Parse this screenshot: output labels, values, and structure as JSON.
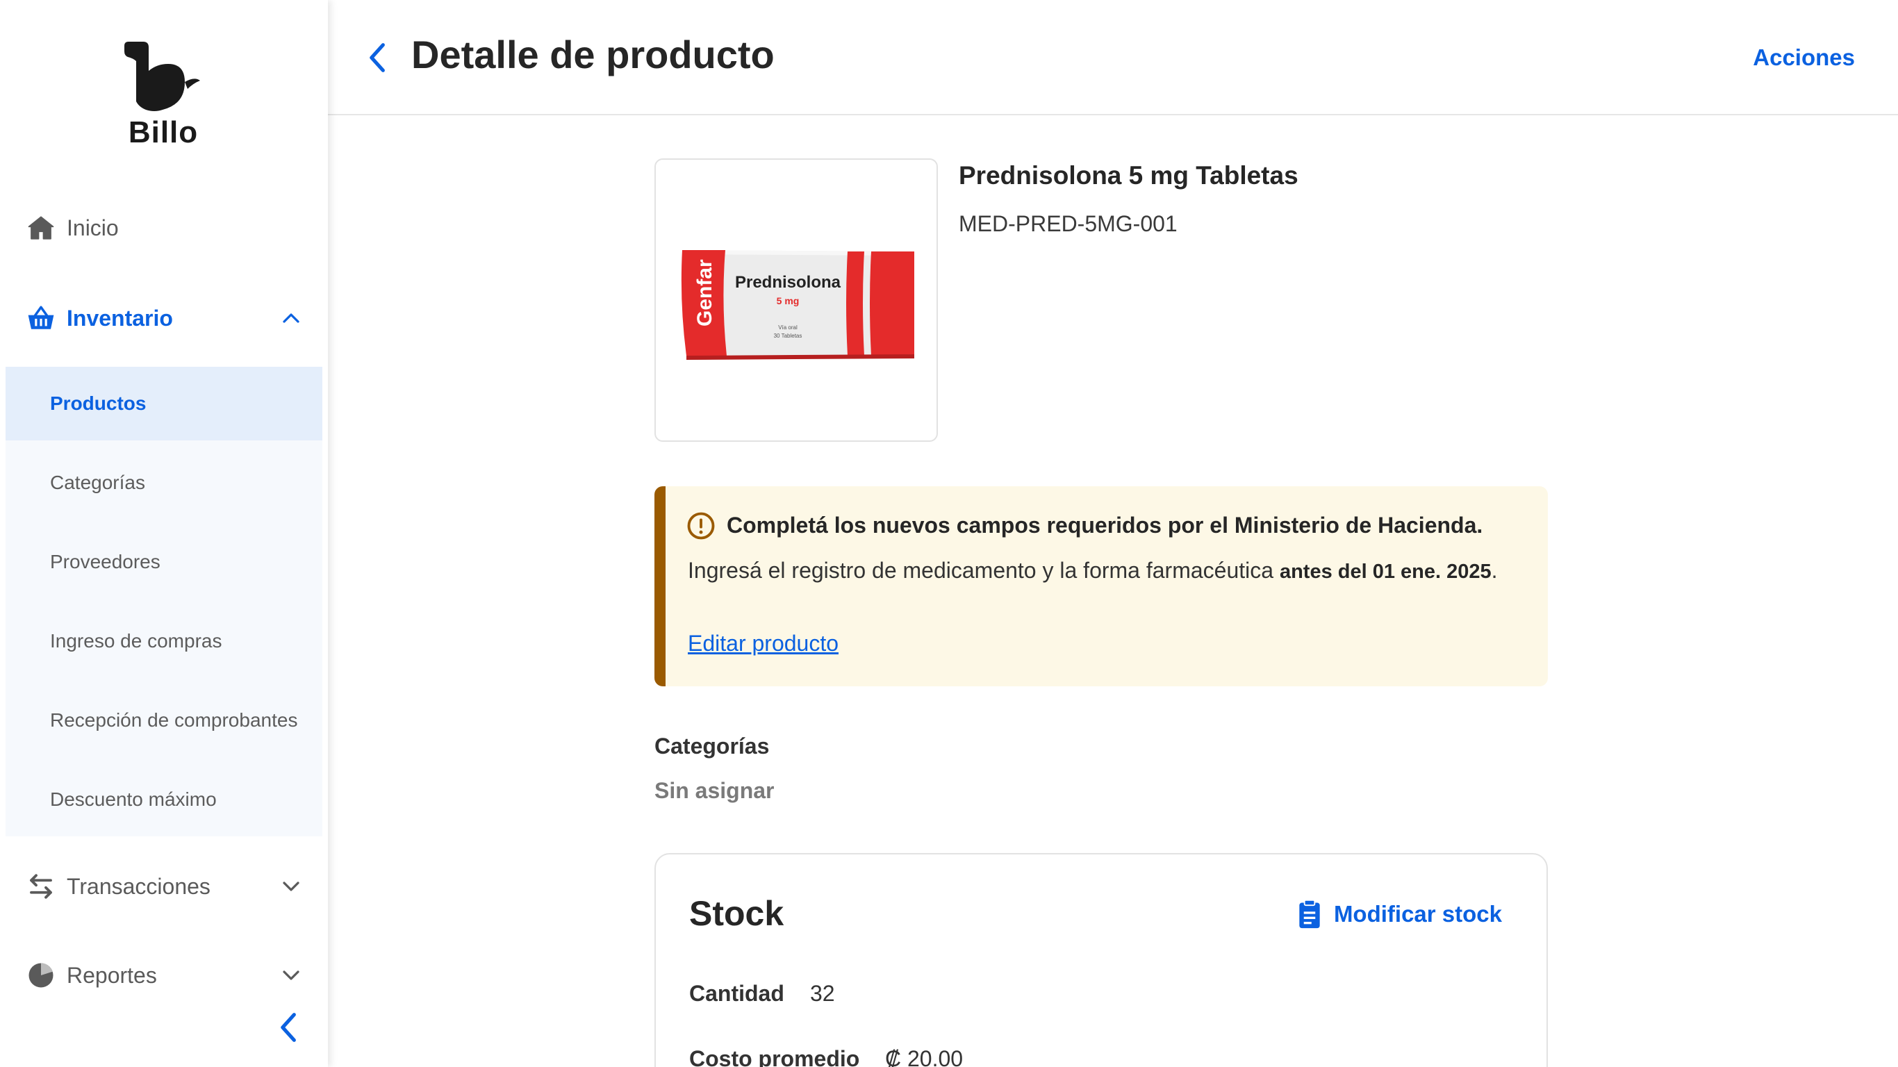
{
  "brand": {
    "name": "Billo"
  },
  "colors": {
    "accent": "#0b61e0",
    "alert_bg": "#fdf8e6",
    "alert_bar": "#9a5a00",
    "submenu_bg": "#f6f9fd",
    "selected_bg": "#e4eefb"
  },
  "sidebar": {
    "items": [
      {
        "label": "Inicio",
        "icon": "home-icon"
      },
      {
        "label": "Inventario",
        "icon": "basket-icon",
        "expanded": true
      },
      {
        "label": "Transacciones",
        "icon": "swap-arrows-icon",
        "expanded": false
      },
      {
        "label": "Reportes",
        "icon": "pie-chart-icon",
        "expanded": false
      }
    ],
    "inventory_submenu": [
      {
        "label": "Productos",
        "selected": true
      },
      {
        "label": "Categorías"
      },
      {
        "label": "Proveedores"
      },
      {
        "label": "Ingreso de compras"
      },
      {
        "label": "Recepción de comprobantes"
      },
      {
        "label": "Descuento máximo"
      }
    ]
  },
  "header": {
    "title": "Detalle de producto",
    "actions_label": "Acciones"
  },
  "product": {
    "name": "Prednisolona 5 mg Tabletas",
    "sku": "MED-PRED-5MG-001",
    "image": {
      "brand": "Genfar",
      "drug": "Prednisolona",
      "dose": "5 mg",
      "route": "Vía oral",
      "count": "30 Tabletas"
    }
  },
  "alert": {
    "title": "Completá los nuevos campos requeridos por el Ministerio de Hacienda.",
    "body_prefix": "Ingresá el registro de medicamento y la forma farmacéutica ",
    "body_bold": "antes del 01 ene. 2025",
    "body_suffix": ".",
    "link_label": "Editar producto"
  },
  "categories": {
    "label": "Categorías",
    "value": "Sin asignar"
  },
  "stock": {
    "title": "Stock",
    "modify_label": "Modificar stock",
    "quantity_label": "Cantidad",
    "quantity_value": "32",
    "avg_cost_label": "Costo promedio",
    "avg_cost_value": "₡ 20.00"
  }
}
